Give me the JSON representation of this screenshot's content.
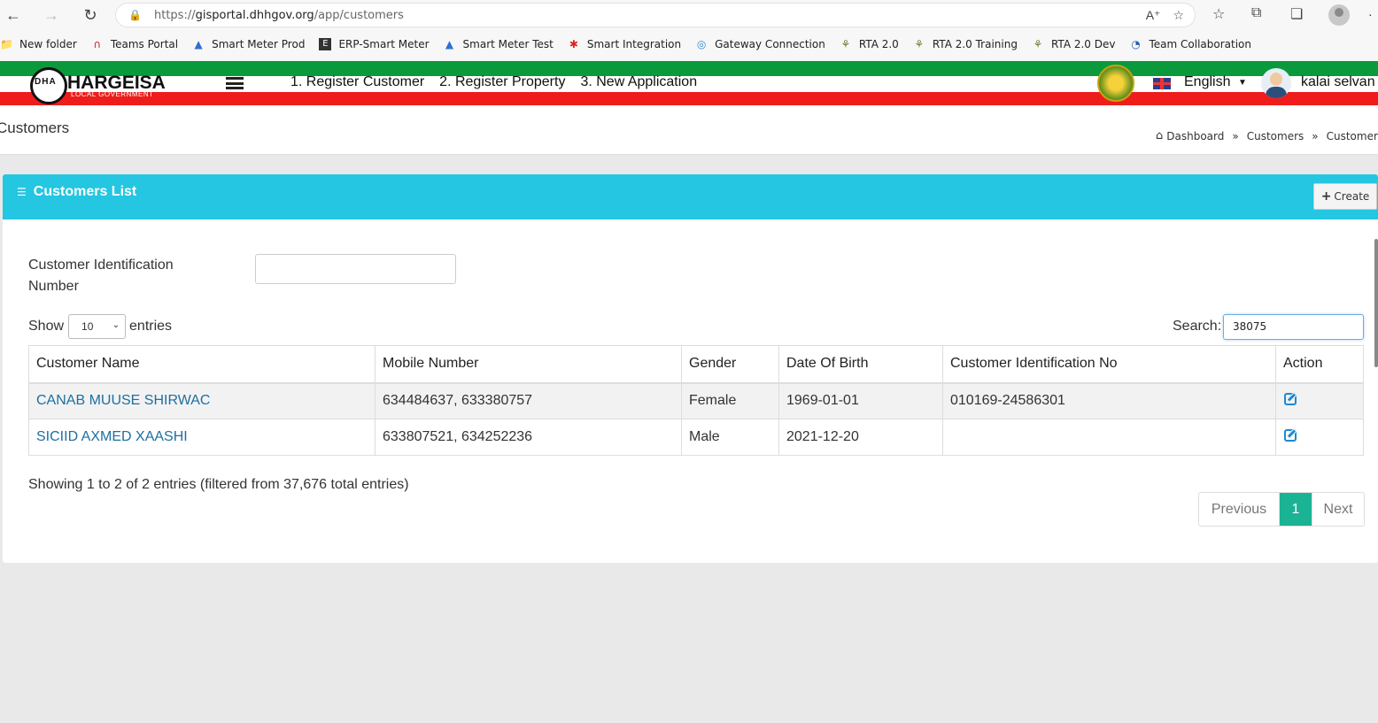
{
  "browser": {
    "url_prefix": "https://",
    "url_domain": "gisportal.dhhgov.org",
    "url_path": "/app/customers",
    "bookmarks": [
      {
        "label": "New folder",
        "icon": "folder-icon"
      },
      {
        "label": "Teams Portal",
        "icon": "teams-icon"
      },
      {
        "label": "Smart Meter Prod",
        "icon": "drop-icon"
      },
      {
        "label": "ERP-Smart Meter",
        "icon": "erp-icon"
      },
      {
        "label": "Smart Meter Test",
        "icon": "drop-icon"
      },
      {
        "label": "Smart Integration",
        "icon": "integration-icon"
      },
      {
        "label": "Gateway Connection",
        "icon": "gateway-icon"
      },
      {
        "label": "RTA 2.0",
        "icon": "emblem-icon"
      },
      {
        "label": "RTA 2.0 Training",
        "icon": "emblem-icon"
      },
      {
        "label": "RTA 2.0 Dev",
        "icon": "emblem-icon"
      },
      {
        "label": "Team Collaboration",
        "icon": "collab-icon"
      }
    ]
  },
  "header": {
    "logo_text": "HARGEISA",
    "logo_sub": "LOCAL GOVERNMENT",
    "logo_mark": "DHA",
    "menu": [
      "1. Register Customer",
      "2. Register Property",
      "3. New Application"
    ],
    "language": "English",
    "user_name": "kalai selvan",
    "colors": {
      "green": "#0a9a3c",
      "red": "#ef1c1c"
    }
  },
  "page": {
    "title": "Customers",
    "breadcrumb": [
      "Dashboard",
      "Customers",
      "Customers L"
    ],
    "breadcrumb_sep": "»"
  },
  "panel": {
    "title": "Customers List",
    "create_label": "Create",
    "accent": "#24c6e1",
    "filter_label": "Customer Identification Number",
    "filter_value": "",
    "show_label": "Show",
    "entries_label": "entries",
    "entries_value": "10",
    "search_label": "Search:",
    "search_value": "38075"
  },
  "table": {
    "columns": [
      "Customer Name",
      "Mobile Number",
      "Gender",
      "Date Of Birth",
      "Customer Identification No",
      "Action"
    ],
    "rows": [
      {
        "name": "CANAB MUUSE SHIRWAC",
        "mobile": "634484637, 633380757",
        "gender": "Female",
        "dob": "1969-01-01",
        "cin": "010169-24586301"
      },
      {
        "name": "SICIID AXMED XAASHI",
        "mobile": "633807521, 634252236",
        "gender": "Male",
        "dob": "2021-12-20",
        "cin": ""
      }
    ]
  },
  "footer": {
    "info": "Showing 1 to 2 of 2 entries (filtered from 37,676 total entries)",
    "prev": "Previous",
    "page": "1",
    "next": "Next"
  }
}
